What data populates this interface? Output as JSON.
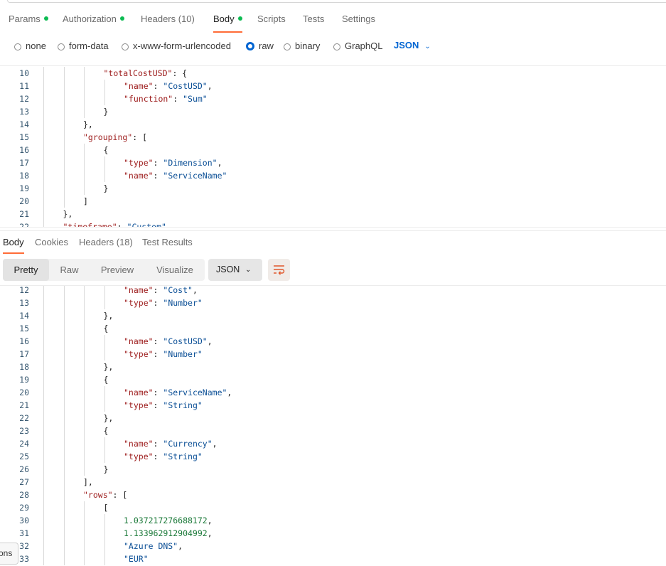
{
  "request_tabs": [
    {
      "label": "Params",
      "dot": true,
      "active": false
    },
    {
      "label": "Authorization",
      "dot": true,
      "active": false
    },
    {
      "label": "Headers (10)",
      "dot": false,
      "active": false
    },
    {
      "label": "Body",
      "dot": true,
      "active": true
    },
    {
      "label": "Scripts",
      "dot": false,
      "active": false
    },
    {
      "label": "Tests",
      "dot": false,
      "active": false
    },
    {
      "label": "Settings",
      "dot": false,
      "active": false
    }
  ],
  "body_types": [
    {
      "label": "none",
      "checked": false
    },
    {
      "label": "form-data",
      "checked": false
    },
    {
      "label": "x-www-form-urlencoded",
      "checked": false
    },
    {
      "label": "raw",
      "checked": true
    },
    {
      "label": "binary",
      "checked": false
    },
    {
      "label": "GraphQL",
      "checked": false
    }
  ],
  "body_format": "JSON",
  "request_code": [
    {
      "n": "10",
      "i": 3,
      "t": [
        [
          "k",
          "\"totalCostUSD\""
        ],
        [
          "p",
          ": {"
        ]
      ]
    },
    {
      "n": "11",
      "i": 4,
      "t": [
        [
          "k",
          "\"name\""
        ],
        [
          "p",
          ": "
        ],
        [
          "s",
          "\"CostUSD\""
        ],
        [
          "p",
          ","
        ]
      ]
    },
    {
      "n": "12",
      "i": 4,
      "t": [
        [
          "k",
          "\"function\""
        ],
        [
          "p",
          ": "
        ],
        [
          "s",
          "\"Sum\""
        ]
      ]
    },
    {
      "n": "13",
      "i": 3,
      "t": [
        [
          "p",
          "}"
        ]
      ]
    },
    {
      "n": "14",
      "i": 2,
      "t": [
        [
          "p",
          "},"
        ]
      ]
    },
    {
      "n": "15",
      "i": 2,
      "t": [
        [
          "k",
          "\"grouping\""
        ],
        [
          "p",
          ": ["
        ]
      ]
    },
    {
      "n": "16",
      "i": 3,
      "t": [
        [
          "p",
          "{"
        ]
      ]
    },
    {
      "n": "17",
      "i": 4,
      "t": [
        [
          "k",
          "\"type\""
        ],
        [
          "p",
          ": "
        ],
        [
          "s",
          "\"Dimension\""
        ],
        [
          "p",
          ","
        ]
      ]
    },
    {
      "n": "18",
      "i": 4,
      "t": [
        [
          "k",
          "\"name\""
        ],
        [
          "p",
          ": "
        ],
        [
          "s",
          "\"ServiceName\""
        ]
      ]
    },
    {
      "n": "19",
      "i": 3,
      "t": [
        [
          "p",
          "}"
        ]
      ]
    },
    {
      "n": "20",
      "i": 2,
      "t": [
        [
          "p",
          "]"
        ]
      ]
    },
    {
      "n": "21",
      "i": 1,
      "t": [
        [
          "p",
          "},"
        ]
      ]
    },
    {
      "n": "22",
      "i": 1,
      "t": [
        [
          "k",
          "\"timeframe\""
        ],
        [
          "p",
          ": "
        ],
        [
          "s",
          "\"Custom\""
        ]
      ]
    }
  ],
  "response_tabs": [
    {
      "label": "Body",
      "active": true
    },
    {
      "label": "Cookies",
      "active": false
    },
    {
      "label": "Headers (18)",
      "active": false
    },
    {
      "label": "Test Results",
      "active": false
    }
  ],
  "response_views": [
    {
      "label": "Pretty",
      "active": true
    },
    {
      "label": "Raw",
      "active": false
    },
    {
      "label": "Preview",
      "active": false
    },
    {
      "label": "Visualize",
      "active": false
    }
  ],
  "response_format": "JSON",
  "response_code": [
    {
      "n": "12",
      "i": 4,
      "t": [
        [
          "k",
          "\"name\""
        ],
        [
          "p",
          ": "
        ],
        [
          "s",
          "\"Cost\""
        ],
        [
          "p",
          ","
        ]
      ]
    },
    {
      "n": "13",
      "i": 4,
      "t": [
        [
          "k",
          "\"type\""
        ],
        [
          "p",
          ": "
        ],
        [
          "s",
          "\"Number\""
        ]
      ]
    },
    {
      "n": "14",
      "i": 3,
      "t": [
        [
          "p",
          "},"
        ]
      ]
    },
    {
      "n": "15",
      "i": 3,
      "t": [
        [
          "p",
          "{"
        ]
      ]
    },
    {
      "n": "16",
      "i": 4,
      "t": [
        [
          "k",
          "\"name\""
        ],
        [
          "p",
          ": "
        ],
        [
          "s",
          "\"CostUSD\""
        ],
        [
          "p",
          ","
        ]
      ]
    },
    {
      "n": "17",
      "i": 4,
      "t": [
        [
          "k",
          "\"type\""
        ],
        [
          "p",
          ": "
        ],
        [
          "s",
          "\"Number\""
        ]
      ]
    },
    {
      "n": "18",
      "i": 3,
      "t": [
        [
          "p",
          "},"
        ]
      ]
    },
    {
      "n": "19",
      "i": 3,
      "t": [
        [
          "p",
          "{"
        ]
      ]
    },
    {
      "n": "20",
      "i": 4,
      "t": [
        [
          "k",
          "\"name\""
        ],
        [
          "p",
          ": "
        ],
        [
          "s",
          "\"ServiceName\""
        ],
        [
          "p",
          ","
        ]
      ]
    },
    {
      "n": "21",
      "i": 4,
      "t": [
        [
          "k",
          "\"type\""
        ],
        [
          "p",
          ": "
        ],
        [
          "s",
          "\"String\""
        ]
      ]
    },
    {
      "n": "22",
      "i": 3,
      "t": [
        [
          "p",
          "},"
        ]
      ]
    },
    {
      "n": "23",
      "i": 3,
      "t": [
        [
          "p",
          "{"
        ]
      ]
    },
    {
      "n": "24",
      "i": 4,
      "t": [
        [
          "k",
          "\"name\""
        ],
        [
          "p",
          ": "
        ],
        [
          "s",
          "\"Currency\""
        ],
        [
          "p",
          ","
        ]
      ]
    },
    {
      "n": "25",
      "i": 4,
      "t": [
        [
          "k",
          "\"type\""
        ],
        [
          "p",
          ": "
        ],
        [
          "s",
          "\"String\""
        ]
      ]
    },
    {
      "n": "26",
      "i": 3,
      "t": [
        [
          "p",
          "}"
        ]
      ]
    },
    {
      "n": "27",
      "i": 2,
      "t": [
        [
          "p",
          "],"
        ]
      ]
    },
    {
      "n": "28",
      "i": 2,
      "t": [
        [
          "k",
          "\"rows\""
        ],
        [
          "p",
          ": ["
        ]
      ]
    },
    {
      "n": "29",
      "i": 3,
      "t": [
        [
          "p",
          "["
        ]
      ]
    },
    {
      "n": "30",
      "i": 4,
      "t": [
        [
          "n",
          "1.037217276688172"
        ],
        [
          "p",
          ","
        ]
      ]
    },
    {
      "n": "31",
      "i": 4,
      "t": [
        [
          "n",
          "1.133962912904992"
        ],
        [
          "p",
          ","
        ]
      ]
    },
    {
      "n": "32",
      "i": 4,
      "t": [
        [
          "s",
          "\"Azure DNS\""
        ],
        [
          "p",
          ","
        ]
      ]
    },
    {
      "n": "33",
      "i": 4,
      "t": [
        [
          "s",
          "\"EUR\""
        ]
      ]
    }
  ],
  "side_tooltip": "ons"
}
